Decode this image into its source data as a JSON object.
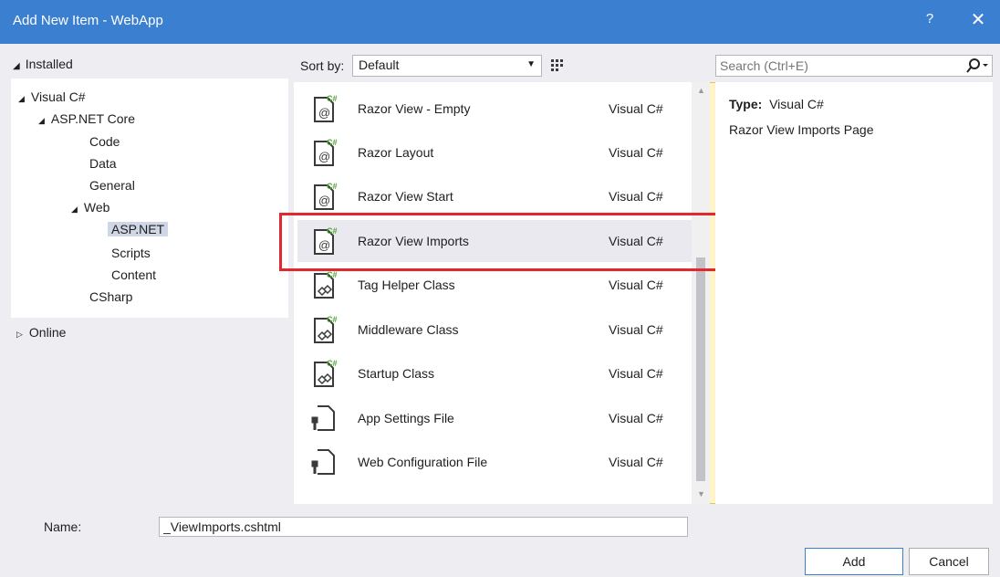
{
  "window": {
    "title": "Add New Item - WebApp",
    "help_label": "?",
    "close_label": "✕"
  },
  "sidebar": {
    "installed_label": "Installed",
    "tree": [
      {
        "label": "Visual C#",
        "expander": "◢"
      },
      {
        "label": "ASP.NET Core",
        "expander": "◢"
      },
      {
        "label": "Code"
      },
      {
        "label": "Data"
      },
      {
        "label": "General"
      },
      {
        "label": "Web",
        "expander": "◢"
      },
      {
        "label": "ASP.NET",
        "selected": true
      },
      {
        "label": "Scripts"
      },
      {
        "label": "Content"
      },
      {
        "label": "CSharp"
      }
    ],
    "online_label": "Online"
  },
  "toolbar": {
    "sort_label": "Sort by:",
    "sort_value": "Default",
    "grid_view_icon": "grid-view-icon",
    "list_view_icon": "list-view-icon"
  },
  "search": {
    "placeholder": "Search (Ctrl+E)",
    "icon": "search-icon"
  },
  "templates": [
    {
      "name": "Razor View - Empty",
      "lang": "Visual C#",
      "icon": "razor-page-icon"
    },
    {
      "name": "Razor Layout",
      "lang": "Visual C#",
      "icon": "razor-page-icon"
    },
    {
      "name": "Razor View Start",
      "lang": "Visual C#",
      "icon": "razor-page-icon"
    },
    {
      "name": "Razor View Imports",
      "lang": "Visual C#",
      "icon": "razor-page-icon",
      "selected": true
    },
    {
      "name": "Tag Helper Class",
      "lang": "Visual C#",
      "icon": "class-file-icon"
    },
    {
      "name": "Middleware Class",
      "lang": "Visual C#",
      "icon": "class-file-icon"
    },
    {
      "name": "Startup Class",
      "lang": "Visual C#",
      "icon": "class-file-icon"
    },
    {
      "name": "App Settings File",
      "lang": "Visual C#",
      "icon": "config-file-icon"
    },
    {
      "name": "Web Configuration File",
      "lang": "Visual C#",
      "icon": "config-file-icon"
    }
  ],
  "details": {
    "type_label": "Type:",
    "type_value": "Visual C#",
    "description": "Razor View Imports Page"
  },
  "footer": {
    "name_label": "Name:",
    "name_value": "_ViewImports.cshtml",
    "add_label": "Add",
    "cancel_label": "Cancel"
  },
  "colors": {
    "titlebar": "#3b7fd1",
    "highlight": "#e2282e",
    "selection": "#cfd6e5"
  }
}
